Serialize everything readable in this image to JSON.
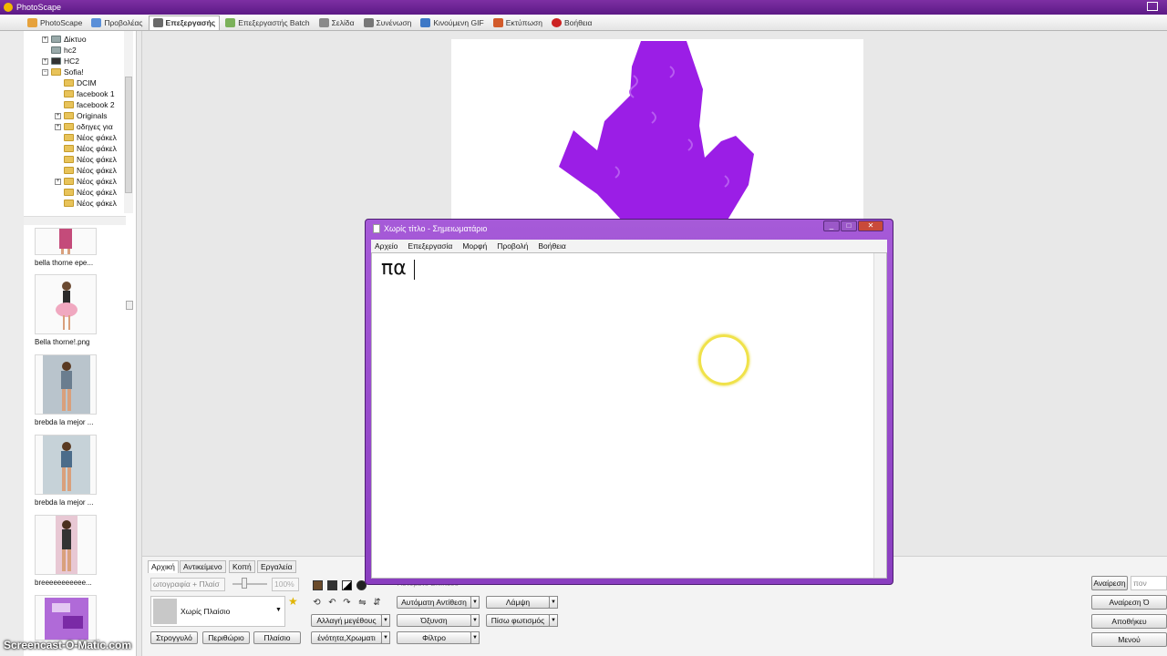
{
  "app": {
    "title": "PhotoScape",
    "accent": "#6a2396"
  },
  "tabs": [
    {
      "label": "PhotoScape",
      "icon": "photoscape-icon",
      "color": "#e6a23c"
    },
    {
      "label": "Προβολέας",
      "icon": "viewer-icon",
      "color": "#5a8fd8"
    },
    {
      "label": "Επεξεργασής",
      "icon": "editor-icon",
      "color": "#6a6a6a"
    },
    {
      "label": "Επεξεργαστής Batch",
      "icon": "batch-icon",
      "color": "#7bb15a"
    },
    {
      "label": "Σελίδα",
      "icon": "page-icon",
      "color": "#8a8a8a"
    },
    {
      "label": "Συνένωση",
      "icon": "combine-icon",
      "color": "#777777"
    },
    {
      "label": "Κινούμενη GIF",
      "icon": "gif-icon",
      "color": "#3d78c6"
    },
    {
      "label": "Εκτύπωση",
      "icon": "print-icon",
      "color": "#d25a2a"
    },
    {
      "label": "Βοήθεια",
      "icon": "help-icon",
      "color": "#cc2222"
    }
  ],
  "tree": {
    "items": [
      "Δίκτυο",
      "hc2",
      "HC2",
      "Sofia!",
      "DCIM",
      "facebook 1",
      "facebook 2",
      "Originals",
      "οδηγες για",
      "Νέος φάκελ",
      "Νέος φάκελ",
      "Νέος φάκελ",
      "Νέος φάκελ",
      "Νέος φάκελ",
      "Νέος φάκελ",
      "Νέος φάκελ"
    ]
  },
  "thumbnails": [
    "bella thorne epe...",
    "Bella thorne!.png",
    "brebda la mejor ...",
    "brebda la mejor ...",
    "breeeeeeeeeee..."
  ],
  "bottom": {
    "tabs": [
      "Αρχική",
      "Αντικείμενο",
      "Κοπή",
      "Εργαλεία"
    ],
    "photo_frame_field": "ωτογραφία + Πλαίσ",
    "zoom": "100%",
    "frame_select": "Χωρίς Πλαίσιο",
    "auto_enhance": "Αυτόματη Αντίθεση",
    "brightness": "Λάμψη",
    "resize": "Αλλαγή μεγέθους",
    "sharpen": "Όξυνση",
    "backlight": "Πίσω φωτισμός",
    "round": "Στρογγυλό",
    "margin": "Περιθώριο",
    "frame": "Πλαίσιο",
    "color": "ένότητα,Χρωματι",
    "filter": "Φίλτρο",
    "obscured": "Αυτόματο Επίπεδο",
    "undo": "Αναίρεση",
    "undo_field": "πον",
    "undo_all": "Αναίρεση Ό",
    "save": "Αποθήκευ",
    "menu": "Μενού"
  },
  "notepad": {
    "title": "Χωρίς τίτλο - Σημειωματάριο",
    "menu": [
      "Αρχείο",
      "Επεξεργασία",
      "Μορφή",
      "Προβολή",
      "Βοήθεια"
    ],
    "content": "πα"
  },
  "image": {
    "silhouette_color": "#9b1ee6"
  },
  "watermark": "Screencast-O-Matic.com"
}
